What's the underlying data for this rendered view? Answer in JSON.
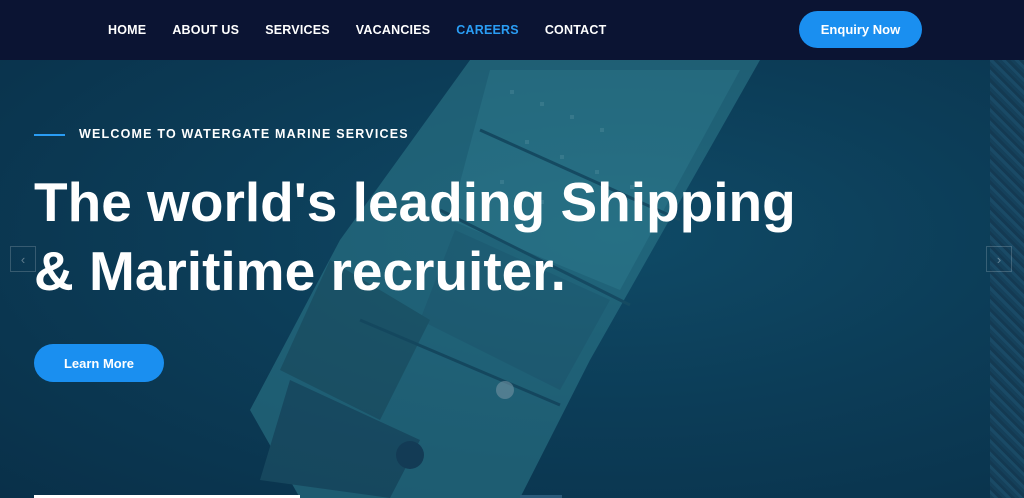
{
  "nav": {
    "items": [
      {
        "label": "HOME"
      },
      {
        "label": "ABOUT US"
      },
      {
        "label": "SERVICES"
      },
      {
        "label": "VACANCIES"
      },
      {
        "label": "CAREERS",
        "active": true
      },
      {
        "label": "CONTACT"
      }
    ],
    "enquiry_label": "Enquiry Now"
  },
  "hero": {
    "eyebrow": "WELCOME TO WATERGATE MARINE SERVICES",
    "headline_line1": "The world's leading Shipping",
    "headline_line2": "& Maritime recruiter.",
    "cta_label": "Learn More",
    "background_image": "aerial-cargo-ship"
  },
  "colors": {
    "nav_bg": "#0b1433",
    "accent": "#1a8ff0",
    "active_link": "#2a9df4",
    "hero_overlay": "#0c3d58"
  }
}
